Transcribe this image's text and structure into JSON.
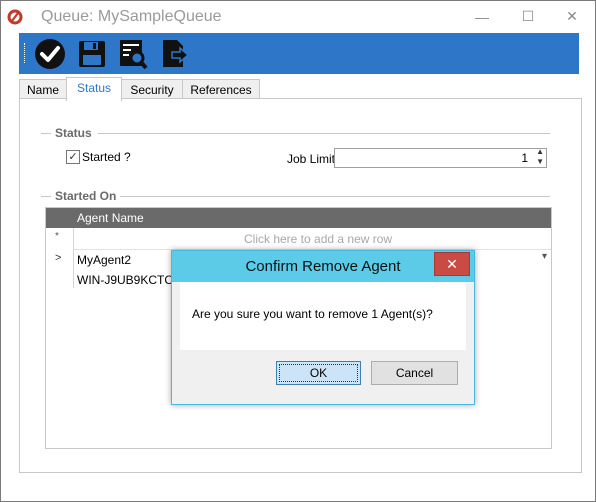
{
  "window": {
    "title": "Queue: MySampleQueue",
    "controls": {
      "minimize": "—",
      "maximize": "☐",
      "close": "✕"
    }
  },
  "toolbar": {
    "buttons": [
      {
        "icon": "checkmark-circle-icon"
      },
      {
        "icon": "save-disk-icon"
      },
      {
        "icon": "document-search-icon"
      },
      {
        "icon": "export-arrow-icon"
      }
    ],
    "background": "#2e76c8"
  },
  "tabs": [
    {
      "label": "Name",
      "active": false
    },
    {
      "label": "Status",
      "active": true
    },
    {
      "label": "Security",
      "active": false
    },
    {
      "label": "References",
      "active": false
    }
  ],
  "status_group": {
    "title": "Status",
    "started_label": "Started ?",
    "started_checked": true,
    "job_limit_label": "Job Limit",
    "job_limit_value": "1"
  },
  "started_on_group": {
    "title": "Started On",
    "column_header": "Agent Name",
    "new_row_marker": "*",
    "new_row_placeholder": "Click here to add a new row",
    "rows": [
      {
        "marker": ">",
        "agent_name": "MyAgent2",
        "sub": "WIN-J9UB9KCTCRQ"
      }
    ],
    "dropdown_glyph": "▾"
  },
  "dialog": {
    "title": "Confirm Remove Agent",
    "close_glyph": "✕",
    "message": "Are you sure you want to remove 1 Agent(s)?",
    "ok_label": "OK",
    "cancel_label": "Cancel"
  },
  "colors": {
    "accent": "#2e76c8",
    "dialog_title": "#5ccbe8",
    "dialog_close": "#c94b44",
    "grid_header": "#6a6a6a"
  }
}
